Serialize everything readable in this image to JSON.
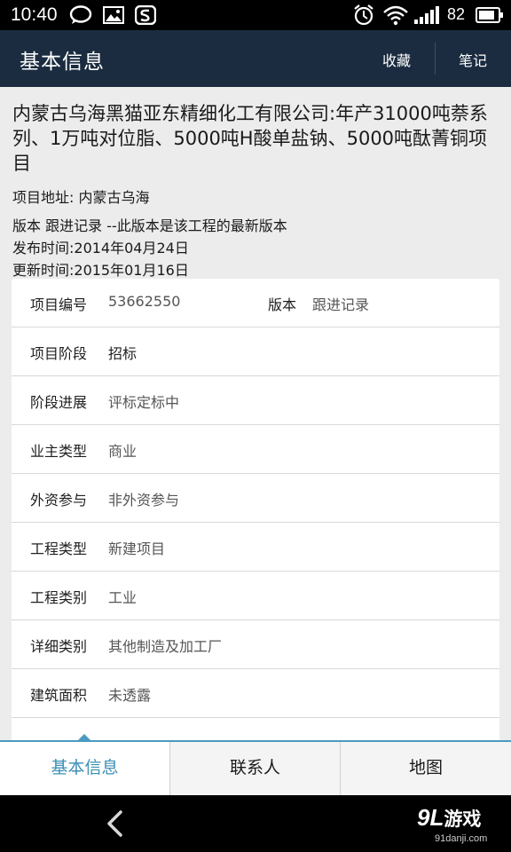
{
  "status": {
    "time": "10:40",
    "battery": "82"
  },
  "app_bar": {
    "title": "基本信息",
    "favorite": "收藏",
    "notes": "笔记"
  },
  "project": {
    "title": "内蒙古乌海黑猫亚东精细化工有限公司:年产31000吨萘系列、1万吨对位脂、5000吨H酸单盐钠、5000吨酞菁铜项目",
    "address": "项目地址: 内蒙古乌海",
    "version_line": "版本 跟进记录 --此版本是该工程的最新版本",
    "published": "发布时间:2014年04月24日",
    "updated": "更新时间:2015年01月16日"
  },
  "details": {
    "project_no_label": "项目编号",
    "project_no": "53662550",
    "version_label": "版本",
    "version": "跟进记录",
    "stage_label": "项目阶段",
    "stage": "招标",
    "progress_label": "阶段进展",
    "progress": "评标定标中",
    "owner_type_label": "业主类型",
    "owner_type": "商业",
    "foreign_label": "外资参与",
    "foreign": "非外资参与",
    "eng_type_label": "工程类型",
    "eng_type": "新建项目",
    "eng_cat_label": "工程类别",
    "eng_cat": "工业",
    "detail_cat_label": "详细类别",
    "detail_cat": "其他制造及加工厂",
    "area_label": "建筑面积",
    "area": "未透露"
  },
  "tabs": [
    "基本信息",
    "联系人",
    "地图"
  ],
  "watermark": {
    "num": "9",
    "mark": "L",
    "cn": "游戏",
    "url": "91danji.com"
  }
}
